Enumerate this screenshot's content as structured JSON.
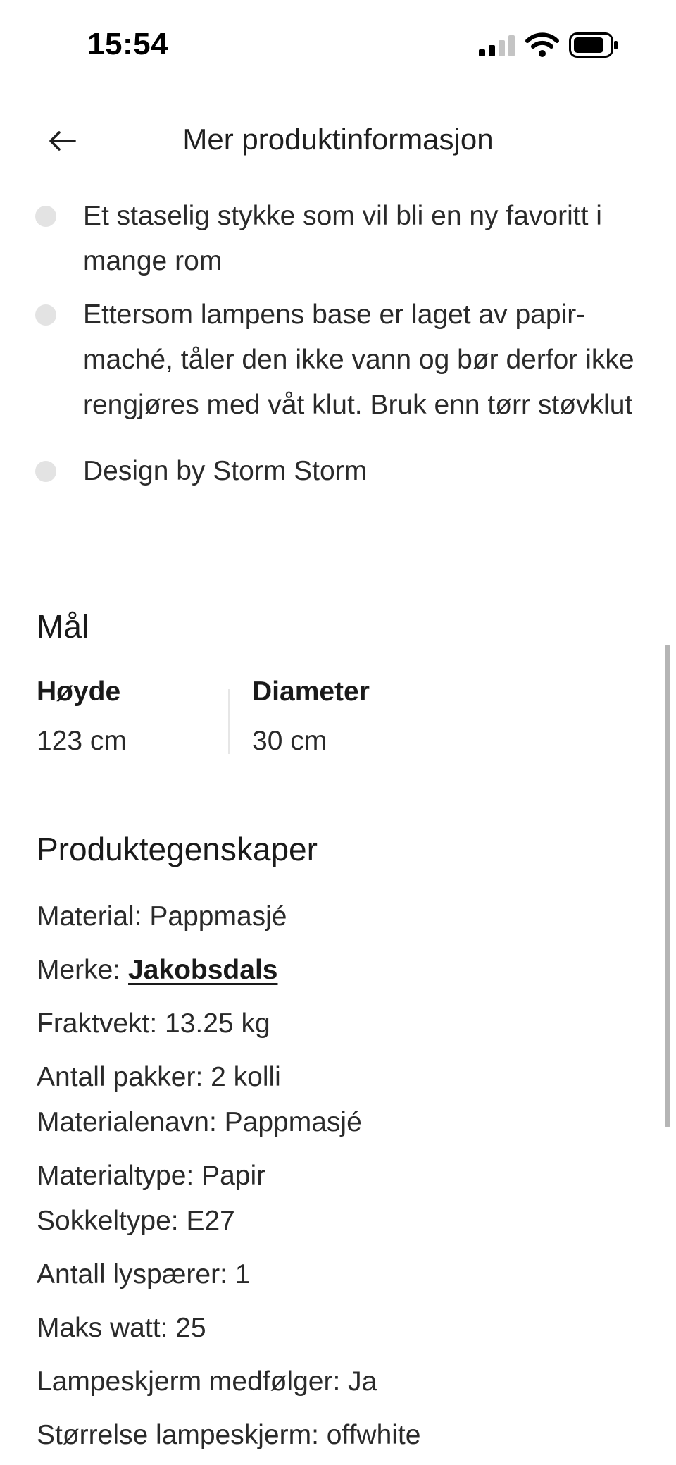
{
  "status_bar": {
    "time": "15:54",
    "icons": [
      "signal-icon",
      "wifi-icon",
      "battery-icon"
    ]
  },
  "header": {
    "back_icon": "arrow-left-icon",
    "title": "Mer produktinformasjon"
  },
  "bullets": [
    "Et staselig stykke som vil bli en ny favoritt i mange rom",
    "Ettersom lampens base er laget av papir-maché, tåler den ikke vann og bør derfor ikke rengjøres med våt klut. Bruk enn tørr støvklut",
    "Design by Storm Storm"
  ],
  "dimensions": {
    "title": "Mål",
    "items": [
      {
        "label": "Høyde",
        "value": "123 cm"
      },
      {
        "label": "Diameter",
        "value": "30 cm"
      }
    ]
  },
  "properties": {
    "title": "Produktegenskaper",
    "material": "Material: Pappmasjé",
    "brand_prefix": "Merke: ",
    "brand_link": "Jakobsdals",
    "shipping_weight": "Fraktvekt: 13.25 kg",
    "packages": "Antall pakker: 2 kolli",
    "material_name": "Materialenavn: Pappmasjé",
    "material_type": "Materialtype: Papir",
    "socket_type": "Sokkeltype: E27",
    "bulb_count": "Antall lyspærer: 1",
    "max_watt": "Maks watt: 25",
    "shade_included": "Lampeskjerm medfølger: Ja",
    "shade_size": "Størrelse lampeskjerm: offwhite"
  },
  "colors": {
    "text": "#1f1f1f",
    "bullet_dot": "#e3e3e3",
    "divider": "#e6e6e6",
    "scrollbar": "#b5b5b5"
  }
}
